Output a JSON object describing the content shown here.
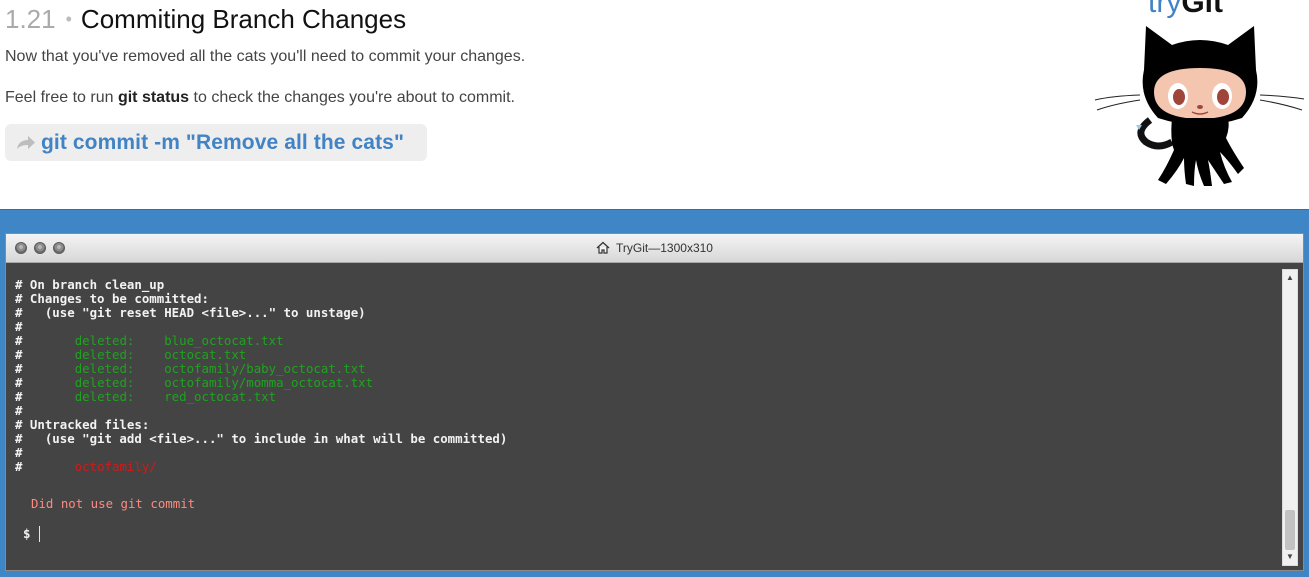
{
  "lesson": {
    "number": "1.21",
    "separator": "•",
    "title": "Commiting Branch Changes",
    "paragraph1": "Now that you've removed all the cats you'll need to commit your changes.",
    "paragraph2_before": "Feel free to run ",
    "paragraph2_cmd": "git status",
    "paragraph2_after": " to check the changes you're about to commit.",
    "command": "git commit -m \"Remove all the cats\""
  },
  "logo": {
    "try": "try",
    "git": "Git"
  },
  "window": {
    "title": "TryGit—1300x310"
  },
  "terminal": {
    "lines": [
      {
        "text": "# On branch clean_up"
      },
      {
        "text": "# Changes to be committed:"
      },
      {
        "text": "#   (use \"git reset HEAD <file>...\" to unstage)"
      },
      {
        "text": "#"
      },
      {
        "text": "#       ",
        "green": "deleted:    blue_octocat.txt"
      },
      {
        "text": "#       ",
        "green": "deleted:    octocat.txt"
      },
      {
        "text": "#       ",
        "green": "deleted:    octofamily/baby_octocat.txt"
      },
      {
        "text": "#       ",
        "green": "deleted:    octofamily/momma_octocat.txt"
      },
      {
        "text": "#       ",
        "green": "deleted:    red_octocat.txt"
      },
      {
        "text": "#"
      },
      {
        "text": "# Untracked files:"
      },
      {
        "text": "#   (use \"git add <file>...\" to include in what will be committed)"
      },
      {
        "text": "#"
      },
      {
        "text": "#       ",
        "red": "octofamily/"
      }
    ],
    "error": "Did not use git commit",
    "prompt": "$"
  },
  "colors": {
    "accent": "#4183c4",
    "frame": "#3e86c6",
    "terminal_bg": "#444444",
    "staged": "#1fa31f",
    "untracked": "#d01a1a",
    "error": "#ff8a80"
  },
  "icons": {
    "command_arrow": "share-arrow-icon",
    "window_title": "home-icon",
    "scroll_up": "chevron-up-icon",
    "scroll_down": "chevron-down-icon"
  }
}
